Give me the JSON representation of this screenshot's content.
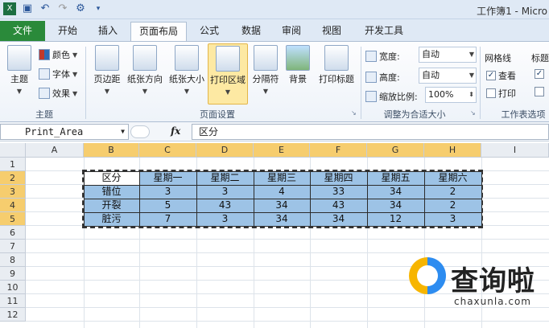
{
  "window": {
    "title": "工作簿1 - Micro"
  },
  "qat": {
    "icons": [
      "save-icon",
      "undo-icon",
      "redo-icon",
      "customize-icon"
    ]
  },
  "tabs": [
    {
      "label": "文件"
    },
    {
      "label": "开始"
    },
    {
      "label": "插入"
    },
    {
      "label": "页面布局"
    },
    {
      "label": "公式"
    },
    {
      "label": "数据"
    },
    {
      "label": "审阅"
    },
    {
      "label": "视图"
    },
    {
      "label": "开发工具"
    }
  ],
  "ribbon": {
    "theme_group": {
      "label": "主题",
      "themes": "主题",
      "colors": "颜色",
      "fonts": "字体",
      "effects": "效果"
    },
    "page_setup": {
      "label": "页面设置",
      "margins": "页边距",
      "orientation": "纸张方向",
      "size": "纸张大小",
      "print_area": "打印区域",
      "breaks": "分隔符",
      "background": "背景",
      "print_titles": "打印标题"
    },
    "scale_to_fit": {
      "label": "调整为合适大小",
      "width_label": "宽度:",
      "width_value": "自动",
      "height_label": "高度:",
      "height_value": "自动",
      "scale_label": "缩放比例:",
      "scale_value": "100%"
    },
    "sheet_options": {
      "label": "工作表选项",
      "gridlines": "网格线",
      "headings": "标题",
      "view": "查看",
      "print": "打印",
      "gridlines_view_checked": true,
      "gridlines_print_checked": false
    }
  },
  "formula_bar": {
    "name_box": "Print_Area",
    "fx": "fx",
    "content": "区分"
  },
  "sheet": {
    "columns": [
      "A",
      "B",
      "C",
      "D",
      "E",
      "F",
      "G",
      "H",
      "I"
    ],
    "rows": [
      "1",
      "2",
      "3",
      "4",
      "5",
      "6",
      "7",
      "8",
      "9",
      "10",
      "11",
      "12"
    ],
    "table": [
      [
        "区分",
        "星期一",
        "星期二",
        "星期三",
        "星期四",
        "星期五",
        "星期六"
      ],
      [
        "错位",
        "3",
        "3",
        "4",
        "33",
        "34",
        "2"
      ],
      [
        "开裂",
        "5",
        "43",
        "34",
        "43",
        "34",
        "2"
      ],
      [
        "脏污",
        "7",
        "3",
        "34",
        "34",
        "12",
        "3"
      ]
    ],
    "data_fill": "#9dc3e6",
    "header_highlight": "#f6cd6e"
  },
  "watermark": {
    "brand": "查询啦",
    "domain": "chaxunla.com"
  }
}
